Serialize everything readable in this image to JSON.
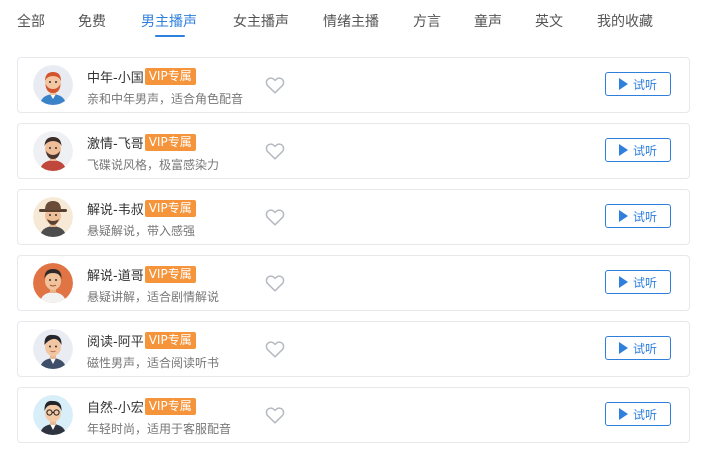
{
  "tabs": [
    {
      "label": "全部"
    },
    {
      "label": "免费"
    },
    {
      "label": "男主播声"
    },
    {
      "label": "女主播声"
    },
    {
      "label": "情绪主播"
    },
    {
      "label": "方言"
    },
    {
      "label": "童声"
    },
    {
      "label": "英文"
    },
    {
      "label": "我的收藏"
    }
  ],
  "active_tab": "男主播声",
  "vip_label": "VIP专属",
  "listen_label": "试听",
  "colors": {
    "accent": "#2f7fdc",
    "vip_badge": "#f5943b",
    "card_border": "#e6e8ec"
  },
  "voices": [
    {
      "name": "中年-小国",
      "desc": "亲和中年男声，适合角色配音",
      "avatar": "man-red-beard-avatar-icon"
    },
    {
      "name": "激情-飞哥",
      "desc": "飞碟说风格，极富感染力",
      "avatar": "man-beard-avatar-icon"
    },
    {
      "name": "解说-韦叔",
      "desc": "悬疑解说，带入感强",
      "avatar": "man-hat-avatar-icon"
    },
    {
      "name": "解说-道哥",
      "desc": "悬疑讲解，适合剧情解说",
      "avatar": "man-orange-avatar-icon"
    },
    {
      "name": "阅读-阿平",
      "desc": "磁性男声，适合阅读听书",
      "avatar": "man-suit-avatar-icon"
    },
    {
      "name": "自然-小宏",
      "desc": "年轻时尚，适用于客服配音",
      "avatar": "man-glasses-avatar-icon"
    }
  ]
}
